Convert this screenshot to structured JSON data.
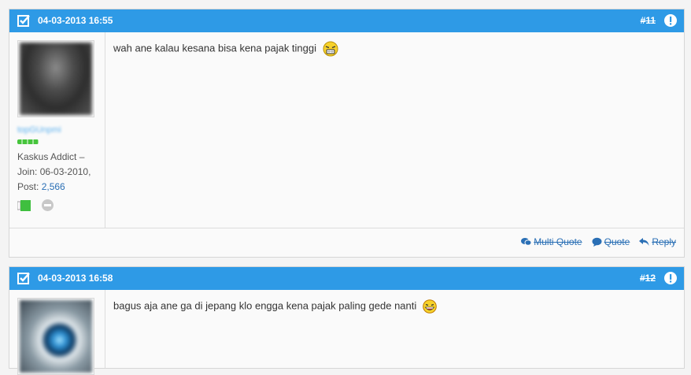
{
  "posts": [
    {
      "date": "04-03-2013 16:55",
      "number": "#11",
      "username": "topGUnpmi",
      "rank": "Kaskus Addict",
      "join_label": "Join:",
      "join_date": "06-03-2010,",
      "post_label": "Post:",
      "post_count": "2,566",
      "message": "wah ane kalau kesana bisa kena pajak tinggi",
      "emoji": "laughing-emoji-icon",
      "actions": {
        "multi_quote": "Multi Quote",
        "quote": "Quote",
        "reply": "Reply"
      }
    },
    {
      "date": "04-03-2013 16:58",
      "number": "#12",
      "message": "bagus aja ane ga di jepang klo engga kena pajak paling gede nanti",
      "emoji": "grinning-emoji-icon"
    }
  ],
  "colors": {
    "header": "#2e9ae6",
    "link": "#2a6fb5",
    "reputation": "#46c43c"
  }
}
